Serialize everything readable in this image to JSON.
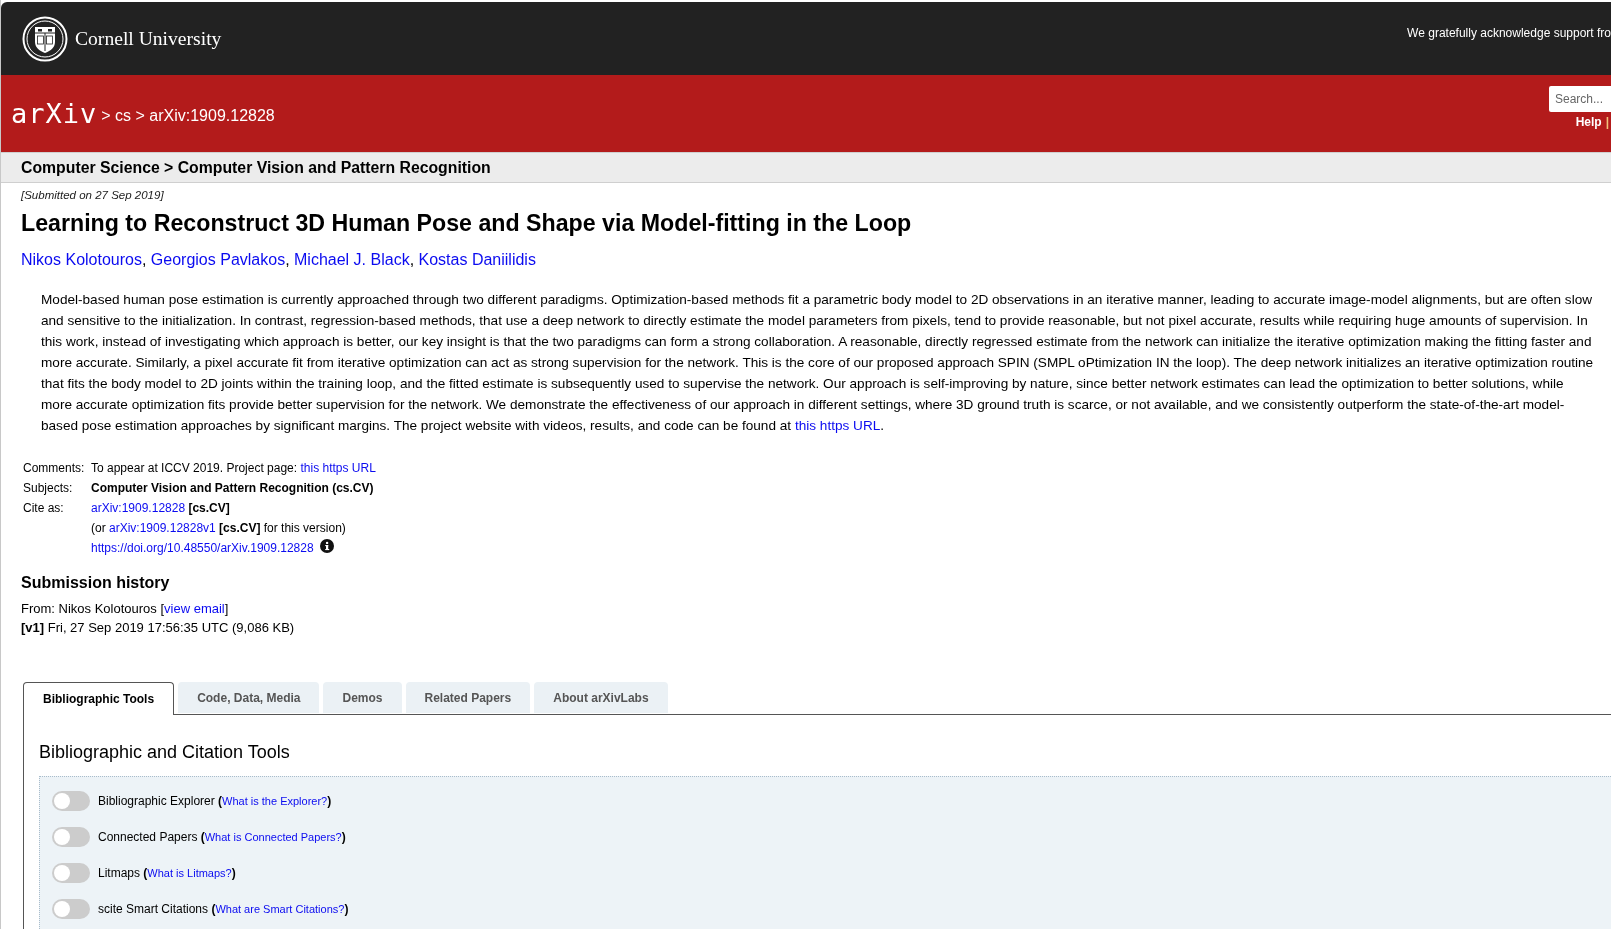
{
  "header": {
    "institution": "Cornell University",
    "support_text": "We gratefully acknowledge support fro"
  },
  "nav": {
    "logo": "arXiv",
    "breadcrumb": "> cs > arXiv:1909.12828",
    "search": {
      "placeholder": "Search..."
    },
    "links": [
      "Help",
      "|"
    ]
  },
  "subheader": "Computer Science > Computer Vision and Pattern Recognition",
  "paper": {
    "submitted": "[Submitted on 27 Sep 2019]",
    "title": "Learning to Reconstruct 3D Human Pose and Shape via Model-fitting in the Loop",
    "authors": [
      {
        "kind": "link",
        "text": "Nikos Kolotouros"
      },
      {
        "kind": "text",
        "text": ", "
      },
      {
        "kind": "link",
        "text": "Georgios Pavlakos"
      },
      {
        "kind": "text",
        "text": ", "
      },
      {
        "kind": "link",
        "text": "Michael J. Black"
      },
      {
        "kind": "text",
        "text": ", "
      },
      {
        "kind": "link",
        "text": "Kostas Daniilidis"
      }
    ],
    "abstract": [
      {
        "kind": "text",
        "text": "Model-based human pose estimation is currently approached through two different paradigms. Optimization-based methods fit a parametric body model to 2D observations in an iterative manner, leading to accurate image-model alignments, but are often slow and sensitive to the initialization. In contrast, regression-based methods, that use a deep network to directly estimate the model parameters from pixels, tend to provide reasonable, but not pixel accurate, results while requiring huge amounts of supervision. In this work, instead of investigating which approach is better, our key insight is that the two paradigms can form a strong collaboration. A reasonable, directly regressed estimate from the network can initialize the iterative optimization making the fitting faster and more accurate. Similarly, a pixel accurate fit from iterative optimization can act as strong supervision for the network. This is the core of our proposed approach SPIN (SMPL oPtimization IN the loop). The deep network initializes an iterative optimization routine that fits the body model to 2D joints within the training loop, and the fitted estimate is subsequently used to supervise the network. Our approach is self-improving by nature, since better network estimates can lead the optimization to better solutions, while more accurate optimization fits provide better supervision for the network. We demonstrate the effectiveness of our approach in different settings, where 3D ground truth is scarce, or not available, and we consistently outperform the state-of-the-art model-based pose estimation approaches by significant margins. The project website with videos, results, and code can be found at "
      },
      {
        "kind": "link",
        "text": "this https URL"
      },
      {
        "kind": "text",
        "text": "."
      }
    ]
  },
  "metadata": [
    {
      "label": "Comments:",
      "lines": [
        {
          "segments": [
            {
              "kind": "text",
              "text": "To appear at ICCV 2019. Project page: "
            },
            {
              "kind": "link",
              "text": "this https URL"
            }
          ]
        }
      ]
    },
    {
      "label": "Subjects:",
      "lines": [
        {
          "segments": [
            {
              "kind": "strong",
              "text": "Computer Vision and Pattern Recognition (cs.CV)"
            }
          ]
        }
      ]
    },
    {
      "label": "Cite as:",
      "lines": [
        {
          "segments": [
            {
              "kind": "link",
              "text": "arXiv:1909.12828"
            },
            {
              "kind": "strong",
              "text": " [cs.CV]"
            }
          ]
        },
        {
          "segments": [
            {
              "kind": "text",
              "text": "(or "
            },
            {
              "kind": "link",
              "text": "arXiv:1909.12828v1"
            },
            {
              "kind": "strong",
              "text": " [cs.CV]"
            },
            {
              "kind": "text",
              "text": " for this version)"
            }
          ]
        },
        {
          "segments": [
            {
              "kind": "link",
              "text": "https://doi.org/10.48550/arXiv.1909.12828"
            }
          ],
          "info": true
        }
      ]
    }
  ],
  "history": {
    "heading": "Submission history",
    "lines": [
      [
        {
          "kind": "text",
          "text": "From: Nikos Kolotouros ["
        },
        {
          "kind": "link",
          "text": "view email"
        },
        {
          "kind": "text",
          "text": "]"
        }
      ],
      [
        {
          "kind": "strong",
          "text": "[v1]"
        },
        {
          "kind": "text",
          "text": " Fri, 27 Sep 2019 17:56:35 UTC (9,086 KB)"
        }
      ]
    ]
  },
  "tabs": [
    {
      "label": "Bibliographic Tools",
      "selected": true
    },
    {
      "label": "Code, Data, Media",
      "selected": false
    },
    {
      "label": "Demos",
      "selected": false
    },
    {
      "label": "Related Papers",
      "selected": false
    },
    {
      "label": "About arXivLabs",
      "selected": false
    }
  ],
  "tools": {
    "heading": "Bibliographic and Citation Tools",
    "items": [
      {
        "checked": false,
        "segments": [
          {
            "kind": "text",
            "text": "Bibliographic Explorer "
          },
          {
            "kind": "strong",
            "text": "("
          },
          {
            "kind": "link",
            "text": "What is the Explorer?"
          },
          {
            "kind": "strong",
            "text": ")"
          }
        ]
      },
      {
        "checked": false,
        "segments": [
          {
            "kind": "text",
            "text": "Connected Papers "
          },
          {
            "kind": "strong",
            "text": "("
          },
          {
            "kind": "link",
            "text": "What is Connected Papers?"
          },
          {
            "kind": "strong",
            "text": ")"
          }
        ]
      },
      {
        "checked": false,
        "segments": [
          {
            "kind": "text",
            "text": "Litmaps "
          },
          {
            "kind": "strong",
            "text": "("
          },
          {
            "kind": "link",
            "text": "What is Litmaps?"
          },
          {
            "kind": "strong",
            "text": ")"
          }
        ]
      },
      {
        "checked": false,
        "segments": [
          {
            "kind": "text",
            "text": "scite Smart Citations "
          },
          {
            "kind": "strong",
            "text": "("
          },
          {
            "kind": "link",
            "text": "What are Smart Citations?"
          },
          {
            "kind": "strong",
            "text": ")"
          }
        ]
      }
    ]
  }
}
